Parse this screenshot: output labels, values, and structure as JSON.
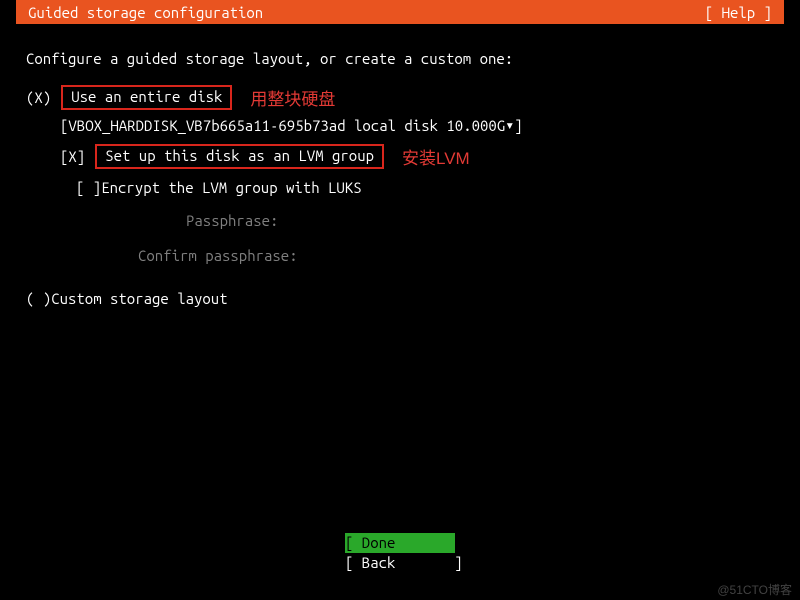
{
  "header": {
    "title": "Guided storage configuration",
    "help": "[ Help ]"
  },
  "intro": "Configure a guided storage layout, or create a custom one:",
  "options": {
    "entire_disk": {
      "marker": "(X)",
      "label": "Use an entire disk",
      "annotation": "用整块硬盘"
    },
    "disk_select": {
      "open": "[ ",
      "value": "VBOX_HARDDISK_VB7b665a11-695b73ad local disk 10.000G",
      "caret": " ▾",
      "close": " ]"
    },
    "lvm": {
      "marker": "[X]",
      "label": "Set up this disk as an LVM group",
      "annotation": "安装LVM"
    },
    "encrypt": {
      "marker": "[ ]",
      "label": "  Encrypt the LVM group with LUKS"
    },
    "passphrase_label": "Passphrase:",
    "confirm_label": "Confirm passphrase:",
    "custom": {
      "marker": "( )",
      "label": "  Custom storage layout"
    }
  },
  "buttons": {
    "done": "[ Done       ]",
    "back": "[ Back       ]"
  },
  "watermark": "@51CTO博客"
}
